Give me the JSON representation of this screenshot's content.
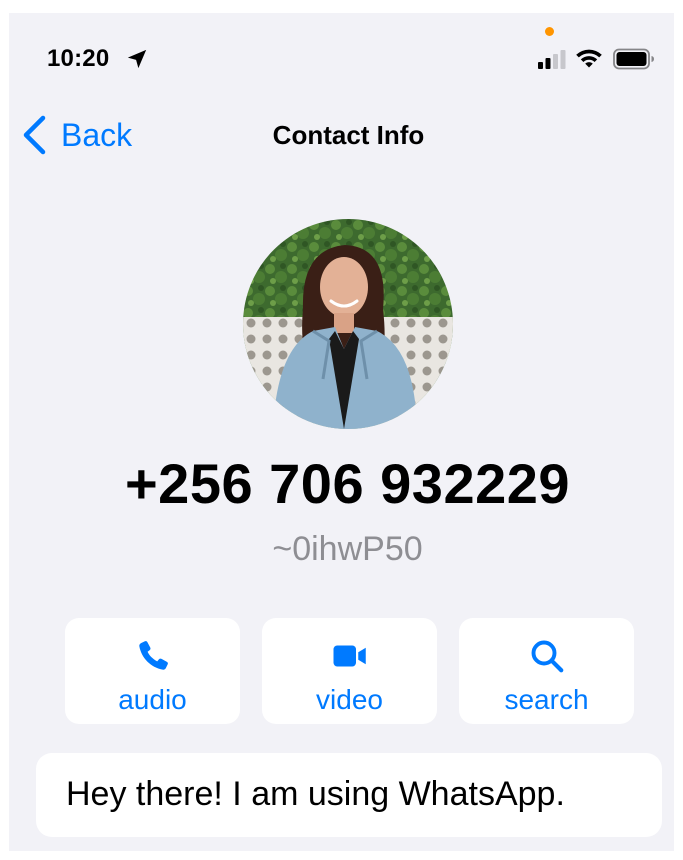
{
  "status_bar": {
    "time": "10:20",
    "location_icon": "location-arrow-icon",
    "privacy_indicator_color": "#ff9500",
    "signal_icon": "cellular-signal-icon",
    "wifi_icon": "wifi-icon",
    "battery_icon": "battery-icon"
  },
  "nav": {
    "back_label": "Back",
    "title": "Contact Info",
    "accent_color": "#007aff"
  },
  "contact": {
    "avatar_icon": "contact-photo",
    "phone": "+256 706 932229",
    "username": "~0ihwP50"
  },
  "actions": [
    {
      "label": "audio",
      "icon": "phone-icon"
    },
    {
      "label": "video",
      "icon": "video-camera-icon"
    },
    {
      "label": "search",
      "icon": "search-icon"
    }
  ],
  "about": {
    "text": "Hey there! I am using WhatsApp."
  }
}
